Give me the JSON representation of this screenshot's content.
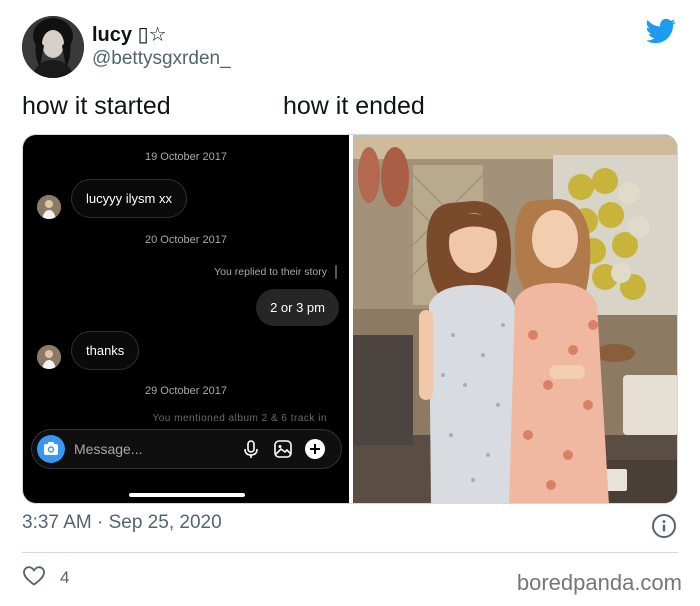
{
  "tweet": {
    "display_name": "lucy ▯☆",
    "handle": "@bettysgxrden_",
    "caption_left": "how it started",
    "caption_right": "how it ended",
    "timestamp": "3:37 AM · Sep 25, 2020",
    "like_count": "4",
    "accent_color": "#1d9bf0"
  },
  "chat": {
    "date_1": "19 October 2017",
    "message_1": "lucyyy ilysm xx",
    "date_2": "20 October 2017",
    "reply_note": "You replied to their story",
    "my_message": "2 or 3 pm",
    "message_2": "thanks",
    "date_3": "29 October 2017",
    "cut_text": "You mentioned album 2 & 6 track in",
    "composer_placeholder": "Message...",
    "camera_color": "#3897f0"
  },
  "icons": {
    "camera": "camera-icon",
    "mic": "microphone-icon",
    "gallery": "image-icon",
    "plus": "plus-circle-icon",
    "twitter": "twitter-bird-icon",
    "info": "info-icon",
    "heart": "heart-icon"
  },
  "watermark": "boredpanda.com"
}
